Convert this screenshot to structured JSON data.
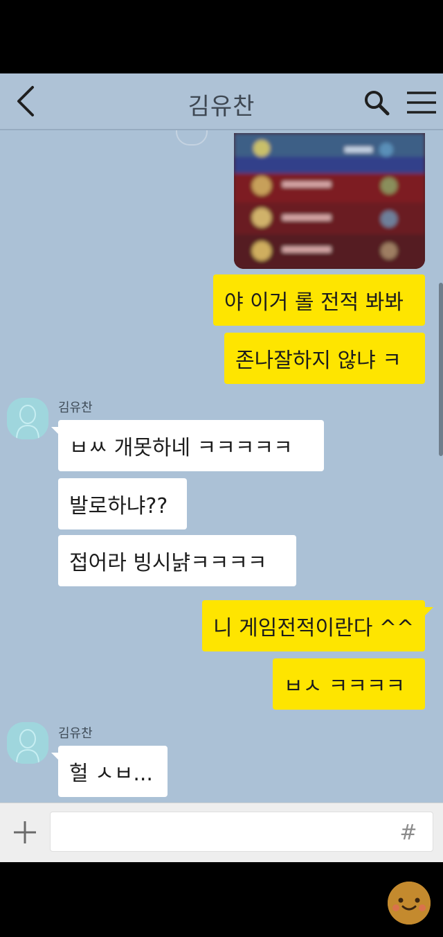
{
  "header": {
    "title": "김유찬",
    "back_icon": "chevron-left-icon",
    "search_icon": "search-icon",
    "menu_icon": "menu-icon"
  },
  "messages": [
    {
      "side": "mine",
      "type": "image",
      "description_icon": "photo-thumbnail"
    },
    {
      "side": "mine",
      "text": "야 이거 롤 전적 봐봐"
    },
    {
      "side": "mine",
      "text": "존나잘하지 않냐 ㅋ"
    },
    {
      "side": "theirs",
      "sender": "김유찬"
    },
    {
      "side": "theirs",
      "text": "ㅂㅆ 개못하네 ㅋㅋㅋㅋㅋ"
    },
    {
      "side": "theirs",
      "text": "발로하냐??"
    },
    {
      "side": "theirs",
      "text": "접어라 빙시냙ㅋㅋㅋㅋ"
    },
    {
      "side": "mine",
      "text": "니 게임전적이란다 ^^"
    },
    {
      "side": "mine",
      "text": "ㅂㅅ ㅋㅋㅋㅋ"
    },
    {
      "side": "theirs",
      "sender": "김유찬"
    },
    {
      "side": "theirs",
      "text": "헐 ㅅㅂ..."
    }
  ],
  "input": {
    "value": "",
    "hash_label": "#",
    "plus_icon": "plus-icon"
  },
  "colors": {
    "chat_bg": "#abc1d6",
    "mine_bubble": "#fee500",
    "theirs_bubble": "#ffffff",
    "header_bg": "#aec2d6"
  }
}
